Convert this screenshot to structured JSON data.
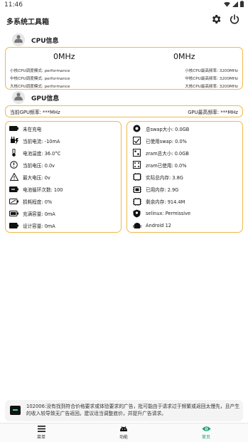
{
  "status_bar": {
    "time": "11:46"
  },
  "app": {
    "title": "多系统工具箱"
  },
  "cpu": {
    "title": "CPU信息",
    "freq_left": "0MHz",
    "freq_right": "0MHz",
    "governors": [
      "小核CPU调度模式: performance",
      "中核CPU调度模式: performance",
      "大核CPU调度模式: performance"
    ],
    "max_freqs": [
      "小核CPU最高频率: 3200MHz",
      "中核CPU最高频率: 3200MHz",
      "大核CPU最高频率: 3200MHz"
    ]
  },
  "gpu": {
    "title": "GPU信息",
    "current": "当前GPU频率: ***MHz",
    "max": "GPU最高频率: ***MHz"
  },
  "battery": [
    {
      "icon": "battery-icon",
      "label": "未在充电"
    },
    {
      "icon": "charging-plug-icon",
      "label": "当前电流: -10mA"
    },
    {
      "icon": "thermometer-icon",
      "label": "电池温度: 36.0°C"
    },
    {
      "icon": "voltage-icon",
      "label": "当前电压: 0.0v"
    },
    {
      "icon": "warning-icon",
      "label": "最大电压: 0v"
    },
    {
      "icon": "battery-cycle-icon",
      "label": "电池循环次数: 100"
    },
    {
      "icon": "battery-health-icon",
      "label": "损耗程度: 0%"
    },
    {
      "icon": "battery-full-icon",
      "label": "充满容量: 0mA"
    },
    {
      "icon": "battery-design-icon",
      "label": "设计容量: 0mA"
    }
  ],
  "memory": [
    {
      "icon": "swap-icon",
      "label": "总swap大小: 0.0GB"
    },
    {
      "icon": "swap-used-icon",
      "label": "已使用swap: 0.0%"
    },
    {
      "icon": "zram-icon",
      "label": "zram总大小: 0.0GB"
    },
    {
      "icon": "zram-used-icon",
      "label": "zram已使用: 0.0%"
    },
    {
      "icon": "ram-icon",
      "label": "实际总内存: 3.8G"
    },
    {
      "icon": "ram-used-icon",
      "label": "已用内存: 2.9G"
    },
    {
      "icon": "ram-free-icon",
      "label": "剩余内存: 914.4M"
    },
    {
      "icon": "selinux-icon",
      "label": "selinux: Permissive"
    },
    {
      "icon": "android-icon",
      "label": "Android 12"
    }
  ],
  "ad": {
    "text": "102006:没有找到符合价格要求或体验要求的广告，批可能由于请求过于频繁或返回太慢先，且产生的收入较导致无广告返回。建议适当调整底价，并提升广告请求。"
  },
  "nav": {
    "items": [
      "菜单",
      "功能",
      "首页"
    ]
  },
  "colors": {
    "accent": "#f2b84b",
    "active": "#1a9e6c"
  }
}
